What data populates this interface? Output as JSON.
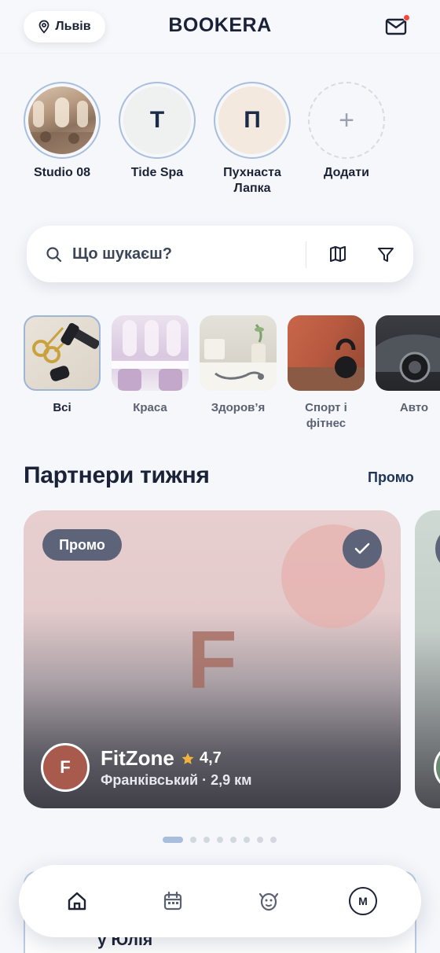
{
  "header": {
    "city": "Львів",
    "logo": "BOOKERA",
    "icons": {
      "location": "map-pin-icon",
      "mail": "mail-icon"
    },
    "has_unread": true
  },
  "favorites": [
    {
      "label": "Studio 08",
      "initial": "",
      "kind": "photo"
    },
    {
      "label": "Tide Spa",
      "initial": "Т",
      "kind": "letter"
    },
    {
      "label": "Пухнаста Лапка",
      "initial": "П",
      "kind": "letter"
    },
    {
      "label": "Додати",
      "initial": "+",
      "kind": "add"
    }
  ],
  "search": {
    "placeholder": "Що шукаєш?",
    "icons": [
      "search-icon",
      "map-icon",
      "filter-icon"
    ]
  },
  "categories": [
    {
      "label": "Всі",
      "active": true
    },
    {
      "label": "Краса",
      "active": false
    },
    {
      "label": "Здоров’я",
      "active": false
    },
    {
      "label": "Спорт і фітнес",
      "active": false
    },
    {
      "label": "Авто",
      "active": false
    }
  ],
  "partners": {
    "title": "Партнери тижня",
    "link": "Промо",
    "card": {
      "badge": "Промо",
      "letter": "F",
      "avatar": "F",
      "name": "FitZone",
      "rating": "4,7",
      "location": "Франківський · 2,9 км"
    },
    "pages": 8,
    "active_page": 1
  },
  "next_section_text": "у Юлія",
  "bottom_nav": {
    "items": [
      "home-icon",
      "calendar-icon",
      "pet-icon",
      "profile-avatar"
    ],
    "profile_initial": "M"
  },
  "colors": {
    "accent": "#a9bedc",
    "dark": "#1a2238",
    "badge": "#5d6479",
    "notification": "#ef4a3c",
    "star": "#f2b33d"
  }
}
